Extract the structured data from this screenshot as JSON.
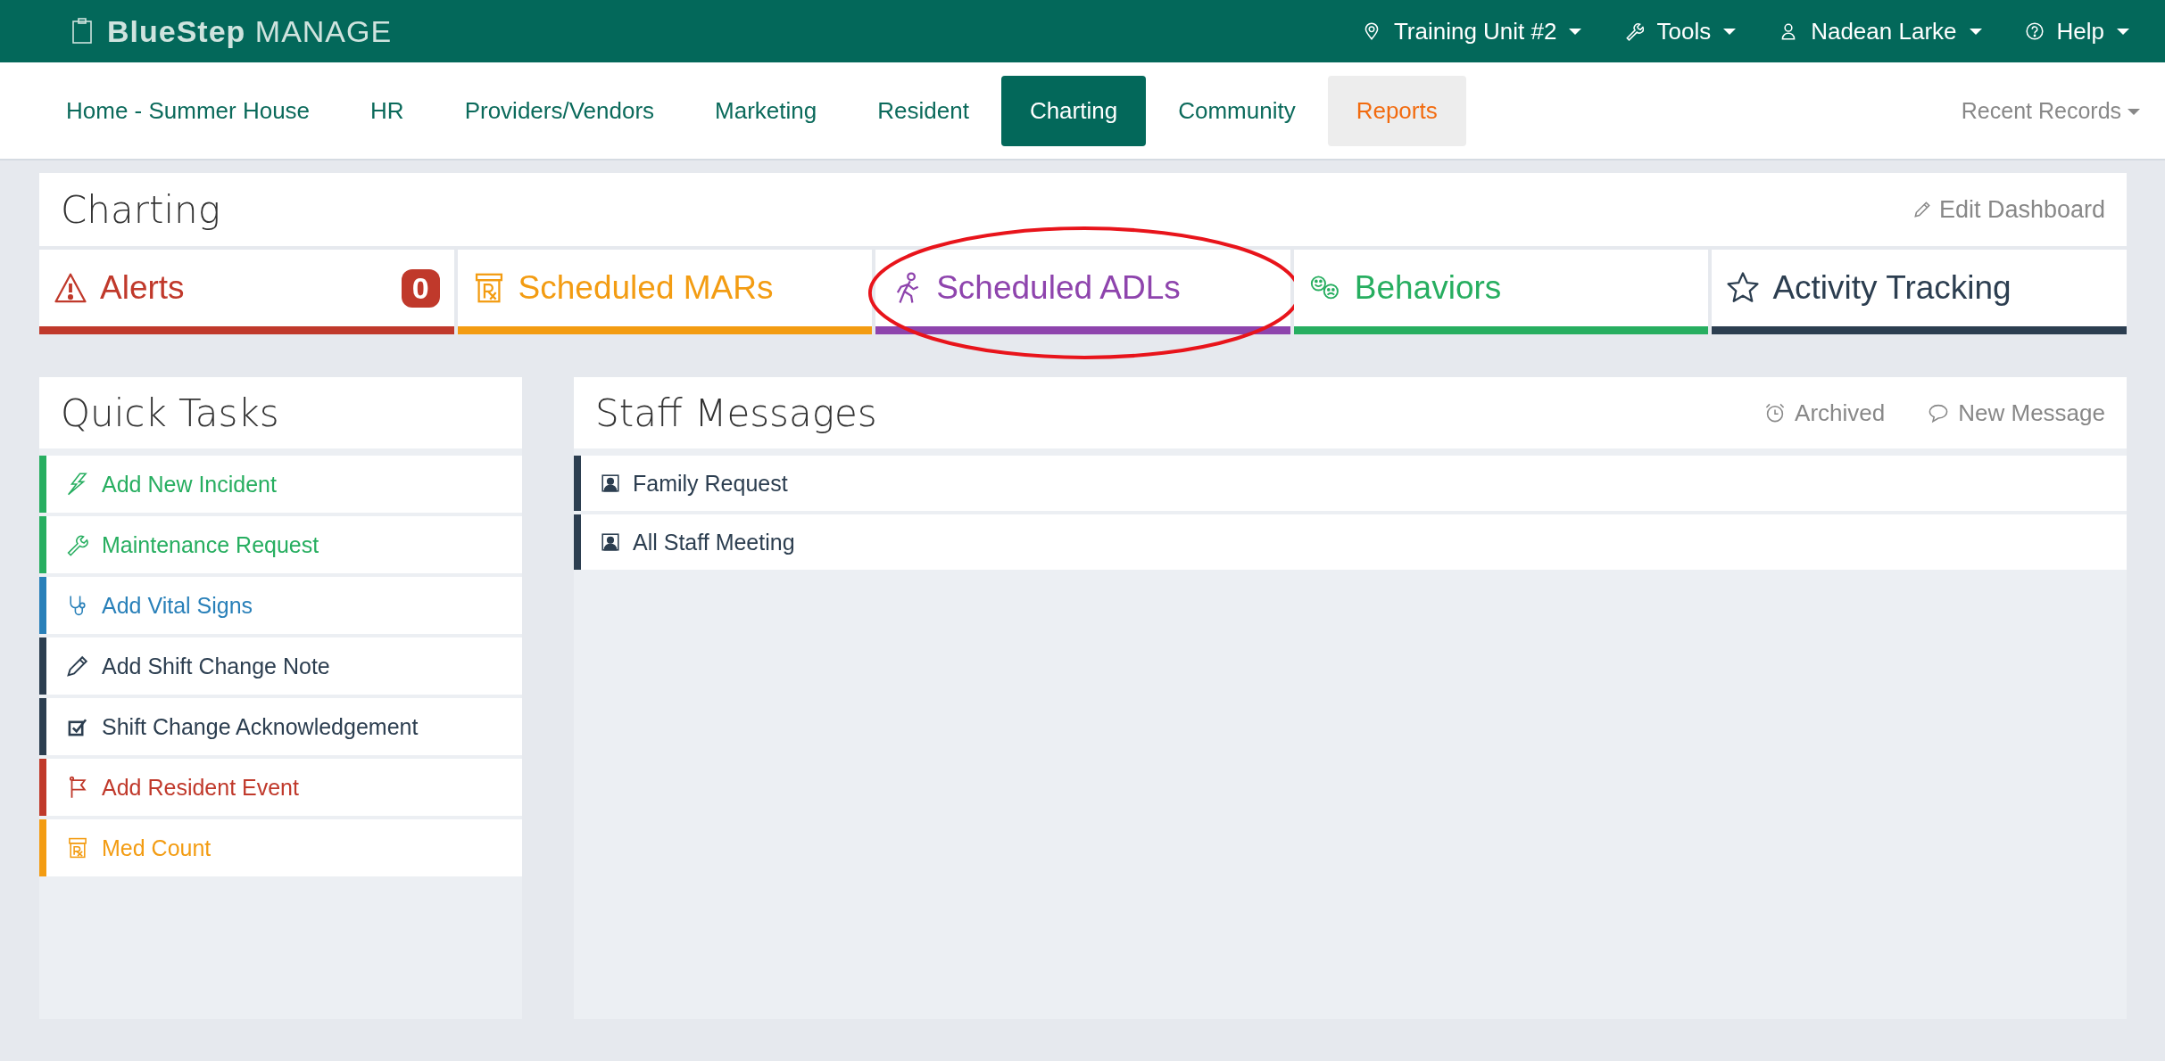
{
  "brand": {
    "bold": "BlueStep",
    "light": "MANAGE"
  },
  "top_menu": [
    {
      "label": "Training Unit #2",
      "kind": "pin"
    },
    {
      "label": "Tools",
      "kind": "wrench"
    },
    {
      "label": "Nadean Larke",
      "kind": "person"
    },
    {
      "label": "Help",
      "kind": "help"
    }
  ],
  "nav": {
    "tabs": [
      {
        "label": "Home - Summer House",
        "selected": false,
        "highlighted": false
      },
      {
        "label": "HR",
        "selected": false,
        "highlighted": false
      },
      {
        "label": "Providers/Vendors",
        "selected": false,
        "highlighted": false
      },
      {
        "label": "Marketing",
        "selected": false,
        "highlighted": false
      },
      {
        "label": "Resident",
        "selected": false,
        "highlighted": false
      },
      {
        "label": "Charting",
        "selected": true,
        "highlighted": false
      },
      {
        "label": "Community",
        "selected": false,
        "highlighted": false
      },
      {
        "label": "Reports",
        "selected": false,
        "highlighted": true
      }
    ],
    "recent_records": "Recent Records"
  },
  "dashboard": {
    "title": "Charting",
    "edit_label": "Edit Dashboard"
  },
  "tiles": [
    {
      "label": "Alerts",
      "kind": "alert",
      "color": "#c0392b",
      "count": "0",
      "circled": false
    },
    {
      "label": "Scheduled MARs",
      "kind": "rx",
      "color": "#f39c12",
      "circled": false
    },
    {
      "label": "Scheduled ADLs",
      "kind": "walker",
      "color": "#8e44ad",
      "circled": true
    },
    {
      "label": "Behaviors",
      "kind": "faces",
      "color": "#27ae60",
      "circled": false
    },
    {
      "label": "Activity Tracking",
      "kind": "star",
      "color": "#2c3e50",
      "circled": false
    }
  ],
  "quick_tasks": {
    "title": "Quick Tasks",
    "items": [
      {
        "label": "Add New Incident",
        "kind": "bolt",
        "color": "#27ae60"
      },
      {
        "label": "Maintenance Request",
        "kind": "wrench",
        "color": "#27ae60"
      },
      {
        "label": "Add Vital Signs",
        "kind": "stethoscope",
        "color": "#2980b9"
      },
      {
        "label": "Add Shift Change Note",
        "kind": "pencil",
        "color": "#2c3e50"
      },
      {
        "label": "Shift Change Acknowledgement",
        "kind": "checkbox",
        "color": "#2c3e50"
      },
      {
        "label": "Add Resident Event",
        "kind": "flag",
        "color": "#c0392b"
      },
      {
        "label": "Med Count",
        "kind": "rx",
        "color": "#f39c12"
      }
    ]
  },
  "staff_messages": {
    "title": "Staff Messages",
    "actions": [
      {
        "label": "Archived",
        "kind": "alarm"
      },
      {
        "label": "New Message",
        "kind": "bubble"
      }
    ],
    "messages": [
      {
        "label": "Family Request"
      },
      {
        "label": "All Staff Meeting"
      }
    ]
  }
}
